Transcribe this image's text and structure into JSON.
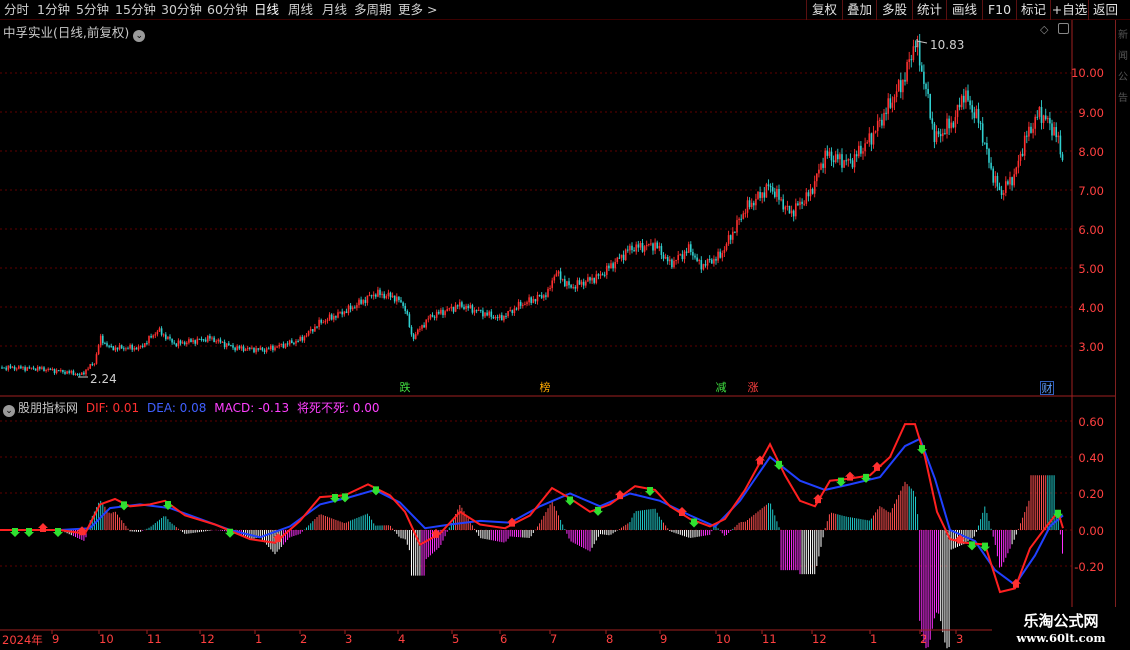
{
  "toolbar": {
    "periods": [
      "分时",
      "1分钟",
      "5分钟",
      "15分钟",
      "30分钟",
      "60分钟",
      "日线",
      "周线",
      "月线",
      "多周期",
      "更多 >"
    ],
    "active_period": "日线",
    "buttons": [
      "复权",
      "叠加",
      "多股",
      "统计",
      "画线",
      "F10",
      "标记",
      "+自选",
      "返回"
    ]
  },
  "main_chart": {
    "title": "中孚实业(日线,前复权)",
    "high_label": "10.83",
    "low_label": "2.24",
    "price_axis": [
      "10.00",
      "9.00",
      "8.00",
      "7.00",
      "6.00",
      "5.00",
      "4.00",
      "3.00"
    ],
    "event_tags": [
      {
        "text": "跌",
        "color": "#40e040"
      },
      {
        "text": "榜",
        "color": "#ffaa00"
      },
      {
        "text": "减",
        "color": "#40e040"
      },
      {
        "text": "涨",
        "color": "#ff4040"
      },
      {
        "text": "财",
        "color": "#60a0ff"
      }
    ],
    "colors": {
      "up": "#ff3030",
      "down": "#30d0d0",
      "grid": "#600000",
      "axis": "#ff4040"
    }
  },
  "indicator": {
    "name": "股朋指标网",
    "dif_label": "DIF: 0.01",
    "dea_label": "DEA: 0.08",
    "macd_label": "MACD: -0.13",
    "jsbs_label": "将死不死: 0.00",
    "axis": [
      "0.60",
      "0.40",
      "0.20",
      "0.00",
      "-0.20"
    ],
    "colors": {
      "dif": "#ff2020",
      "dea": "#2040ff",
      "macd": "#ff40ff",
      "jsbs": "#ff40ff",
      "up_arrow": "#ff3030",
      "down_arrow": "#30e030",
      "pos_bar": "#ff5050",
      "neg_bar": "#ff30ff",
      "cyan_bar": "#20c8c8"
    }
  },
  "date_axis": [
    "2024年",
    "9",
    "10",
    "11",
    "12",
    "1",
    "2",
    "3",
    "4",
    "5",
    "6",
    "7",
    "8",
    "9",
    "10",
    "11",
    "12",
    "1",
    "2",
    "3"
  ],
  "watermark": {
    "name": "乐淘公式网",
    "url": "www.60lt.com"
  },
  "right_strip": [
    "新",
    "闻",
    "公",
    "告"
  ]
}
